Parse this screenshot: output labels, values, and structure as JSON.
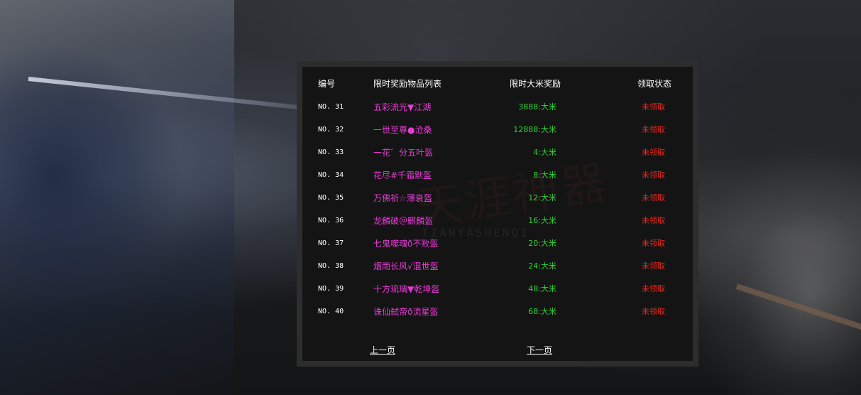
{
  "table": {
    "headers": {
      "no": "编号",
      "items": "限时奖励物品列表",
      "reward": "限时大米奖励",
      "status": "领取状态"
    },
    "rows": [
      {
        "no": "NO. 31",
        "item": "五彩流光▼江湖",
        "reward": "3888:大米",
        "status": "未领取"
      },
      {
        "no": "NO. 32",
        "item": "一世至尊●沧桑",
        "reward": "12888:大米",
        "status": "未领取"
      },
      {
        "no": "NO. 33",
        "item": "一花゛分五叶盔",
        "reward": "4:大米",
        "status": "未领取"
      },
      {
        "no": "NO. 34",
        "item": "花尽#千霜默盔",
        "reward": "8:大米",
        "status": "未领取"
      },
      {
        "no": "NO. 35",
        "item": "万佛祈☆薄衰盔",
        "reward": "12:大米",
        "status": "未领取"
      },
      {
        "no": "NO. 36",
        "item": "龙麟破＠麒麟盔",
        "reward": "16:大米",
        "status": "未领取"
      },
      {
        "no": "NO. 37",
        "item": "七鬼噬魂ð不败盔",
        "reward": "20:大米",
        "status": "未领取"
      },
      {
        "no": "NO. 38",
        "item": "烟雨长风√混世盔",
        "reward": "24:大米",
        "status": "未领取"
      },
      {
        "no": "NO. 39",
        "item": "十方琉璃▼乾坤盔",
        "reward": "48:大米",
        "status": "未领取"
      },
      {
        "no": "NO. 40",
        "item": "诛仙弑帝ð流星盔",
        "reward": "68:大米",
        "status": "未领取"
      }
    ]
  },
  "pager": {
    "prev_label": "上一页",
    "next_label": "下一页"
  },
  "watermark": {
    "title": "天涯神器",
    "subtitle": "TIANYASHENQI"
  },
  "colors": {
    "item_text": "#e93ad7",
    "reward_text": "#2ed434",
    "status_text": "#e82a1e",
    "header_text": "#ffffff",
    "panel_bg": "#141414",
    "panel_border": "#2d2d2d"
  }
}
